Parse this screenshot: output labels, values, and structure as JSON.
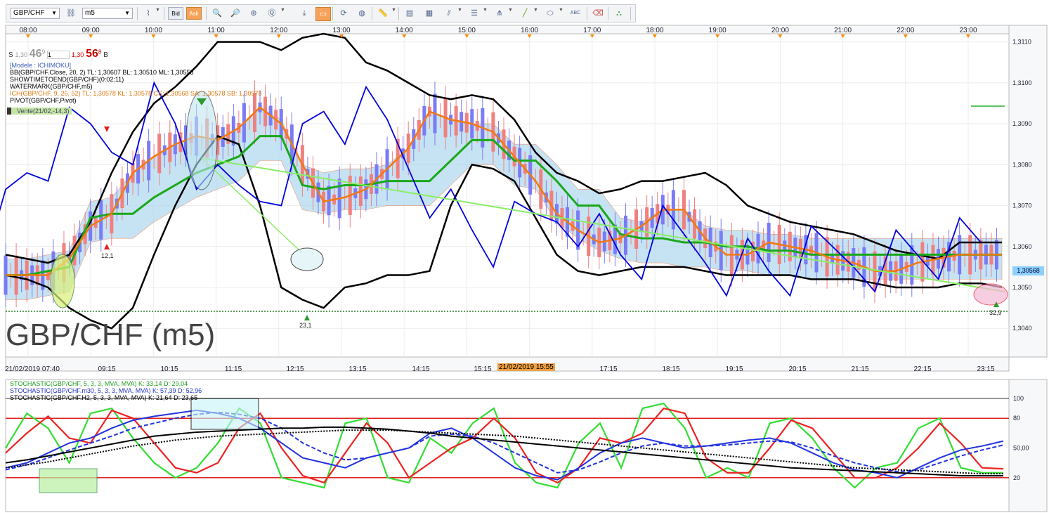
{
  "toolbar": {
    "symbol": "GBP/CHF",
    "timeframe": "m5",
    "bid_label": "Bid",
    "ask_label": "Ask"
  },
  "quote": {
    "sell_label": "S",
    "sell_small": "1,30",
    "sell_big": "46",
    "sell_pip": "9",
    "lot": "1",
    "buy_small": "1,30",
    "buy_big": "56",
    "buy_pip": "8",
    "buy_label": "B"
  },
  "indicators": {
    "model": "[Modele : ICHIMOKU]",
    "bb": "BB(GBP/CHF.Close, 20, 2)  TL: 1,30607  BL: 1,30510  ML: 1,30558",
    "showtime": "SHOWTIMETOEND(GBP/CHF)(0:02:11)",
    "watermark": "WATERMARK(GBP/CHF,m5)",
    "ich": "ICH(GBP/CHF, 9, 26, 52)  TL: 1,30578  KL: 1,30578  CS: 1,30568  SA: 1,30578  SB: 1,30578",
    "pivot": "PIVOT(GBP/CHF,Pivot)",
    "vente": "Vente(21/02,-14,3)"
  },
  "stoch_legend": {
    "s1": "STOCHASTIC(GBP/CHF, 5, 3, 3, MVA, MVA)  K: 33,14  D: 29,04",
    "s2": "STOCHASTIC(GBP/CHF.m30, 5, 3, 3, MVA, MVA)  K: 57,39  D: 52,96",
    "s3": "STOCHASTIC(GBP/CHF.H2, 5, 3, 3, MVA, MVA)  K: 21,64  D: 23,65"
  },
  "chart_title": "GBP/CHF (m5)",
  "top_time_labels": [
    "08:00",
    "09:00",
    "10:00",
    "11:00",
    "12:00",
    "13:00",
    "14:00",
    "15:00",
    "16:00",
    "17:00",
    "18:00",
    "19:00",
    "20:00",
    "21:00",
    "22:00",
    "23:00"
  ],
  "bottom_time_labels": [
    "21/02/2019 07:40",
    "09:15",
    "10:15",
    "11:15",
    "12:15",
    "13:15",
    "14:15",
    "15:15",
    "17:15",
    "18:15",
    "19:15",
    "20:15",
    "21:15",
    "22:15",
    "23:15"
  ],
  "cursor_date": "21/02/2019 15:55",
  "price_axis": [
    "1,3110",
    "1,3100",
    "1,3090",
    "1,3080",
    "1,3070",
    "1,3060",
    "1,3050",
    "1,3040"
  ],
  "last_price": "1,30568",
  "stoch_axis": [
    "100",
    "80",
    "50,00",
    "20"
  ],
  "annotations": {
    "a1": "12,1",
    "a2": "23,1",
    "a3": "32,9"
  },
  "colors": {
    "bb": "#000000",
    "tenkan": "#f07a10",
    "kijun": "#1aa81a",
    "chikou": "#0000e0",
    "cloud_up": "#aed8ef",
    "cloud_down": "#f2c8b5",
    "trend": "#88ee66",
    "candle_up": "#7b7bf5",
    "candle_down": "#f08080",
    "stoch_k": "#33dd33",
    "stoch_d": "#ee2222",
    "stoch_m30": "#2233dd",
    "stoch_h2": "#000000",
    "highlight": "#ff8c00"
  },
  "chart_data": [
    {
      "type": "line",
      "title": "GBP/CHF (m5)",
      "x": [
        "07:40",
        "08:00",
        "08:30",
        "09:00",
        "09:15",
        "09:30",
        "10:00",
        "10:15",
        "10:30",
        "10:45",
        "11:00",
        "11:15",
        "11:30",
        "12:00",
        "12:15",
        "12:30",
        "13:00",
        "13:15",
        "13:30",
        "14:00",
        "14:15",
        "14:30",
        "15:00",
        "15:15",
        "15:30",
        "16:00",
        "16:30",
        "17:00",
        "17:15",
        "17:30",
        "18:00",
        "18:15",
        "18:30",
        "19:00",
        "19:15",
        "19:30",
        "20:00",
        "20:15",
        "20:30",
        "21:00",
        "21:15",
        "21:30",
        "22:00",
        "22:15",
        "22:30",
        "23:00",
        "23:15",
        "23:25"
      ],
      "series": [
        {
          "name": "BB upper",
          "values": [
            1.3058,
            1.3057,
            1.3056,
            1.3058,
            1.3066,
            1.3078,
            1.3088,
            1.3095,
            1.3099,
            1.3104,
            1.311,
            1.311,
            1.311,
            1.3108,
            1.3111,
            1.3112,
            1.3111,
            1.3105,
            1.3103,
            1.31,
            1.3097,
            1.3096,
            1.3097,
            1.3096,
            1.3091,
            1.3083,
            1.3078,
            1.3076,
            1.3073,
            1.3074,
            1.3076,
            1.3076,
            1.3077,
            1.3078,
            1.3075,
            1.307,
            1.3068,
            1.3066,
            1.3065,
            1.3064,
            1.3063,
            1.3061,
            1.3059,
            1.3058,
            1.3057,
            1.3061,
            1.3061,
            1.3061
          ]
        },
        {
          "name": "BB lower",
          "values": [
            1.3053,
            1.3052,
            1.305,
            1.3045,
            1.3042,
            1.304,
            1.3045,
            1.3058,
            1.307,
            1.308,
            1.3087,
            1.3085,
            1.307,
            1.305,
            1.3047,
            1.3045,
            1.305,
            1.3051,
            1.3053,
            1.3053,
            1.3054,
            1.307,
            1.308,
            1.3079,
            1.3076,
            1.3067,
            1.3058,
            1.3054,
            1.3053,
            1.3054,
            1.3055,
            1.3055,
            1.3055,
            1.3054,
            1.3053,
            1.3053,
            1.3053,
            1.3053,
            1.3052,
            1.3052,
            1.3052,
            1.3051,
            1.305,
            1.305,
            1.305,
            1.3051,
            1.3051,
            1.305
          ]
        },
        {
          "name": "Tenkan",
          "values": [
            1.3053,
            1.3053,
            1.3053,
            1.3057,
            1.3065,
            1.3068,
            1.3078,
            1.3082,
            1.3085,
            1.3087,
            1.3086,
            1.3089,
            1.3094,
            1.309,
            1.308,
            1.3071,
            1.3072,
            1.3074,
            1.3079,
            1.3084,
            1.3093,
            1.3091,
            1.309,
            1.3088,
            1.3082,
            1.3076,
            1.3068,
            1.3064,
            1.3061,
            1.3062,
            1.3065,
            1.3069,
            1.3069,
            1.3062,
            1.3058,
            1.3058,
            1.3061,
            1.306,
            1.3059,
            1.3057,
            1.3056,
            1.3054,
            1.3054,
            1.3056,
            1.3057,
            1.3058,
            1.3058,
            1.3058
          ]
        },
        {
          "name": "Kijun",
          "values": [
            1.3053,
            1.3053,
            1.3054,
            1.3055,
            1.3067,
            1.3068,
            1.3068,
            1.3072,
            1.3075,
            1.3078,
            1.308,
            1.3082,
            1.3087,
            1.3087,
            1.3075,
            1.3074,
            1.3075,
            1.3075,
            1.3076,
            1.3076,
            1.3076,
            1.3081,
            1.3086,
            1.3086,
            1.3081,
            1.3081,
            1.3076,
            1.307,
            1.307,
            1.3063,
            1.3062,
            1.3062,
            1.3061,
            1.3061,
            1.306,
            1.306,
            1.3059,
            1.3059,
            1.3058,
            1.3058,
            1.3058,
            1.3058,
            1.3058,
            1.3058,
            1.3058,
            1.3058,
            1.3058,
            1.3058
          ]
        }
      ],
      "ylim": [
        1.3033,
        1.3112
      ]
    },
    {
      "type": "line",
      "title": "STOCHASTIC",
      "ylim": [
        0,
        100
      ],
      "series": [
        {
          "name": "K m5",
          "values": [
            50,
            85,
            70,
            35,
            85,
            90,
            60,
            35,
            20,
            30,
            55,
            90,
            75,
            20,
            15,
            10,
            75,
            80,
            20,
            15,
            60,
            45,
            75,
            90,
            35,
            15,
            10,
            55,
            75,
            30,
            90,
            95,
            70,
            20,
            30,
            20,
            75,
            80,
            60,
            30,
            10,
            30,
            35,
            70,
            80,
            30,
            25,
            25
          ]
        },
        {
          "name": "D m5",
          "values": [
            45,
            65,
            82,
            60,
            55,
            88,
            80,
            55,
            30,
            25,
            35,
            70,
            85,
            50,
            22,
            15,
            45,
            75,
            55,
            20,
            35,
            50,
            60,
            80,
            60,
            25,
            15,
            30,
            60,
            55,
            65,
            90,
            85,
            40,
            25,
            25,
            50,
            78,
            70,
            45,
            20,
            20,
            30,
            50,
            75,
            55,
            30,
            29
          ]
        },
        {
          "name": "K m30",
          "values": [
            30,
            35,
            45,
            55,
            60,
            70,
            78,
            82,
            85,
            88,
            85,
            80,
            70,
            55,
            40,
            35,
            30,
            40,
            45,
            50,
            65,
            70,
            60,
            45,
            30,
            22,
            18,
            30,
            45,
            55,
            60,
            55,
            50,
            52,
            55,
            58,
            60,
            55,
            45,
            35,
            28,
            25,
            20,
            30,
            40,
            48,
            52,
            57
          ]
        },
        {
          "name": "D m30",
          "values": [
            28,
            33,
            40,
            48,
            55,
            62,
            70,
            75,
            80,
            84,
            86,
            84,
            80,
            70,
            55,
            45,
            38,
            40,
            45,
            50,
            62,
            64,
            62,
            55,
            45,
            35,
            25,
            28,
            36,
            45,
            52,
            55,
            52,
            52,
            53,
            55,
            57,
            56,
            50,
            42,
            35,
            30,
            26,
            28,
            35,
            42,
            48,
            53
          ]
        },
        {
          "name": "K H2",
          "values": [
            35,
            38,
            42,
            46,
            50,
            54,
            58,
            62,
            64,
            66,
            67,
            68,
            69,
            70,
            70,
            71,
            71,
            70,
            69,
            67,
            65,
            62,
            60,
            58,
            56,
            54,
            52,
            50,
            48,
            46,
            44,
            42,
            40,
            38,
            36,
            34,
            32,
            30,
            29,
            28,
            27,
            26,
            25,
            24,
            23,
            22,
            22,
            22
          ]
        },
        {
          "name": "D H2",
          "values": [
            30,
            33,
            36,
            40,
            44,
            48,
            52,
            55,
            58,
            60,
            62,
            63,
            64,
            65,
            66,
            67,
            68,
            68,
            68,
            67,
            66,
            65,
            64,
            63,
            62,
            60,
            58,
            56,
            54,
            52,
            50,
            48,
            46,
            44,
            42,
            40,
            38,
            36,
            34,
            32,
            30,
            29,
            28,
            27,
            26,
            25,
            24,
            24
          ]
        }
      ]
    }
  ]
}
